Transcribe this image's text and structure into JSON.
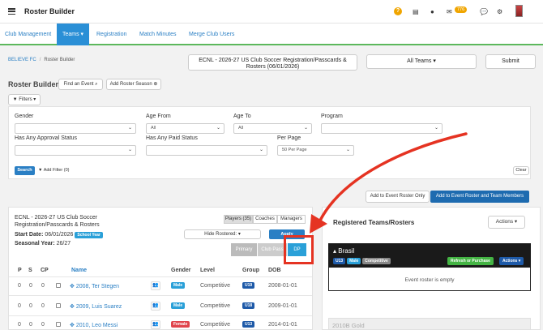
{
  "app": {
    "title": "Roster Builder",
    "notification_count": "776"
  },
  "nav": {
    "items": [
      {
        "label": "Club Management"
      },
      {
        "label": "Teams ▾"
      },
      {
        "label": "Registration"
      },
      {
        "label": "Match Minutes"
      },
      {
        "label": "Merge Club Users"
      }
    ]
  },
  "breadcrumb": {
    "root": "BELIEVE FC",
    "current": "Roster Builder"
  },
  "event_select": {
    "line1": "ECNL - 2026-27 US Club Soccer Registration/Passcards &",
    "line2": "Rosters (06/01/2026)"
  },
  "teams_select": "All Teams ▾",
  "submit_label": "Submit",
  "page": {
    "title": "Roster Builder",
    "find_event_label": "Find an Event",
    "add_roster_season_label": "Add Roster Season",
    "filters_label": "Filters ▾"
  },
  "filters": {
    "gender": {
      "label": "Gender",
      "value": ""
    },
    "age_from": {
      "label": "Age From",
      "value": "All"
    },
    "age_to": {
      "label": "Age To",
      "value": "All"
    },
    "program": {
      "label": "Program",
      "value": ""
    },
    "approval": {
      "label": "Has Any Approval Status",
      "value": ""
    },
    "paid": {
      "label": "Has Any Paid Status",
      "value": ""
    },
    "per_page": {
      "label": "Per Page",
      "value": "50 Per Page"
    },
    "search_label": "Search",
    "add_filter_label": "Add Filter (0)",
    "clear_label": "Clear"
  },
  "actions": {
    "add_event_roster_only": "Add to Event Roster Only",
    "add_roster_and_members": "Add to Event Roster and Team Members"
  },
  "event_panel": {
    "title_line1": "ECNL - 2026-27 US Club Soccer",
    "title_line2": "Registration/Passcards & Rosters",
    "tabs": [
      "Players (35)",
      "Coaches",
      "Managers"
    ],
    "start_date_label": "Start Date:",
    "start_date": "06/01/2026",
    "school_year_tag": "School Year",
    "seasonal_year_label": "Seasonal Year:",
    "seasonal_year": "26/27",
    "hide_rostered_label": "Hide Rostered:",
    "apply_label": "Apply",
    "pass_tabs": [
      "Primary",
      "Club Pass",
      "DP"
    ]
  },
  "table": {
    "headers": [
      "P",
      "S",
      "CP",
      "",
      "Name",
      "",
      "Gender",
      "Level",
      "Group",
      "DOB"
    ],
    "rows": [
      {
        "p": "0",
        "s": "0",
        "cp": "0",
        "name": "2008, Ter Stegen",
        "gender": "Male",
        "level": "Competitive",
        "group": "U19",
        "dob": "2008-01-01"
      },
      {
        "p": "0",
        "s": "0",
        "cp": "0",
        "name": "2009, Luis Suarez",
        "gender": "Male",
        "level": "Competitive",
        "group": "U18",
        "dob": "2009-01-01"
      },
      {
        "p": "0",
        "s": "0",
        "cp": "0",
        "name": "2010, Leo Messi",
        "gender": "Female",
        "level": "Competitive",
        "group": "U13",
        "dob": "2014-01-01"
      }
    ]
  },
  "registered": {
    "title": "Registered Teams/Rosters",
    "actions_label": "Actions ▾",
    "team_name": "Brasil",
    "tags": [
      "U13",
      "Male",
      "Competitive"
    ],
    "refresh_label": "Refresh or Purchase",
    "team_actions_label": "Actions ▾",
    "empty_message": "Event roster is empty",
    "next_team": "2010B Gold"
  },
  "colors": {
    "primary": "#2a7fc4",
    "nav_active": "#2a8fd6",
    "accent_green": "#5cb85c",
    "highlight_red": "#e53322"
  }
}
